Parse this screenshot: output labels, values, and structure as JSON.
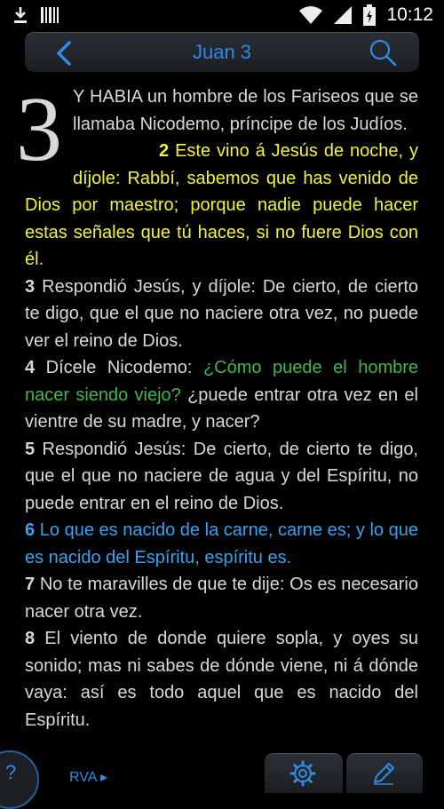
{
  "statusbar": {
    "time": "10:12",
    "left_icons": [
      "download-icon",
      "barcode-icon"
    ],
    "right_icons": [
      "wifi-icon",
      "signal-icon",
      "battery-icon"
    ]
  },
  "toolbar": {
    "title": "Juan 3",
    "back_icon": "chevron-left-icon",
    "search_icon": "search-icon"
  },
  "chapter": {
    "number": "3"
  },
  "verses": [
    {
      "num": "",
      "text": "Y HABIA un hombre de los Fariseos que se llamaba Nicodemo, príncipe de los Judíos.",
      "color": "#d8d8d8"
    },
    {
      "num": "2",
      "text": "Este vino á Jesús de noche, y díjole: Rabbí, sabemos que has venido de Dios por maestro; porque nadie puede hacer estas señales que tú haces, si no fuere Dios con él.",
      "color": "#f2f23a"
    },
    {
      "num": "3",
      "text": "Respondió Jesús, y díjole: De cierto, de cierto te digo, que el que no naciere otra vez, no puede ver el reino de Dios.",
      "color": "#d8d8d8"
    },
    {
      "num": "4",
      "text_a": "Dícele Nicodemo:",
      "text_b": "¿Cómo puede el hombre nacer siendo viejo?",
      "text_c": "¿puede entrar otra vez en el vientre de su madre, y nacer?",
      "color_b": "#3fb64a"
    },
    {
      "num": "5",
      "text": "Respondió Jesús: De cierto, de cierto te digo, que el que no naciere de agua y del Espíritu, no puede entrar en el reino de Dios.",
      "color": "#d8d8d8"
    },
    {
      "num": "6",
      "text": "Lo que es nacido de la carne, carne es; y lo que es nacido del Espíritu, espíritu es.",
      "color": "#35a4f0"
    },
    {
      "num": "7",
      "text": "No te maravilles de que te dije: Os es necesario nacer otra vez.",
      "color": "#d8d8d8"
    },
    {
      "num": "8",
      "text": "El viento de donde quiere sopla, y oyes su sonido; mas ni sabes de dónde viene, ni á dónde vaya: así es todo aquel que es nacido del Espíritu.",
      "color": "#d8d8d8"
    }
  ],
  "bottom": {
    "help_label": "?",
    "version_label": "RVA ▸",
    "settings_icon": "gear-icon",
    "edit_icon": "pencil-icon"
  }
}
